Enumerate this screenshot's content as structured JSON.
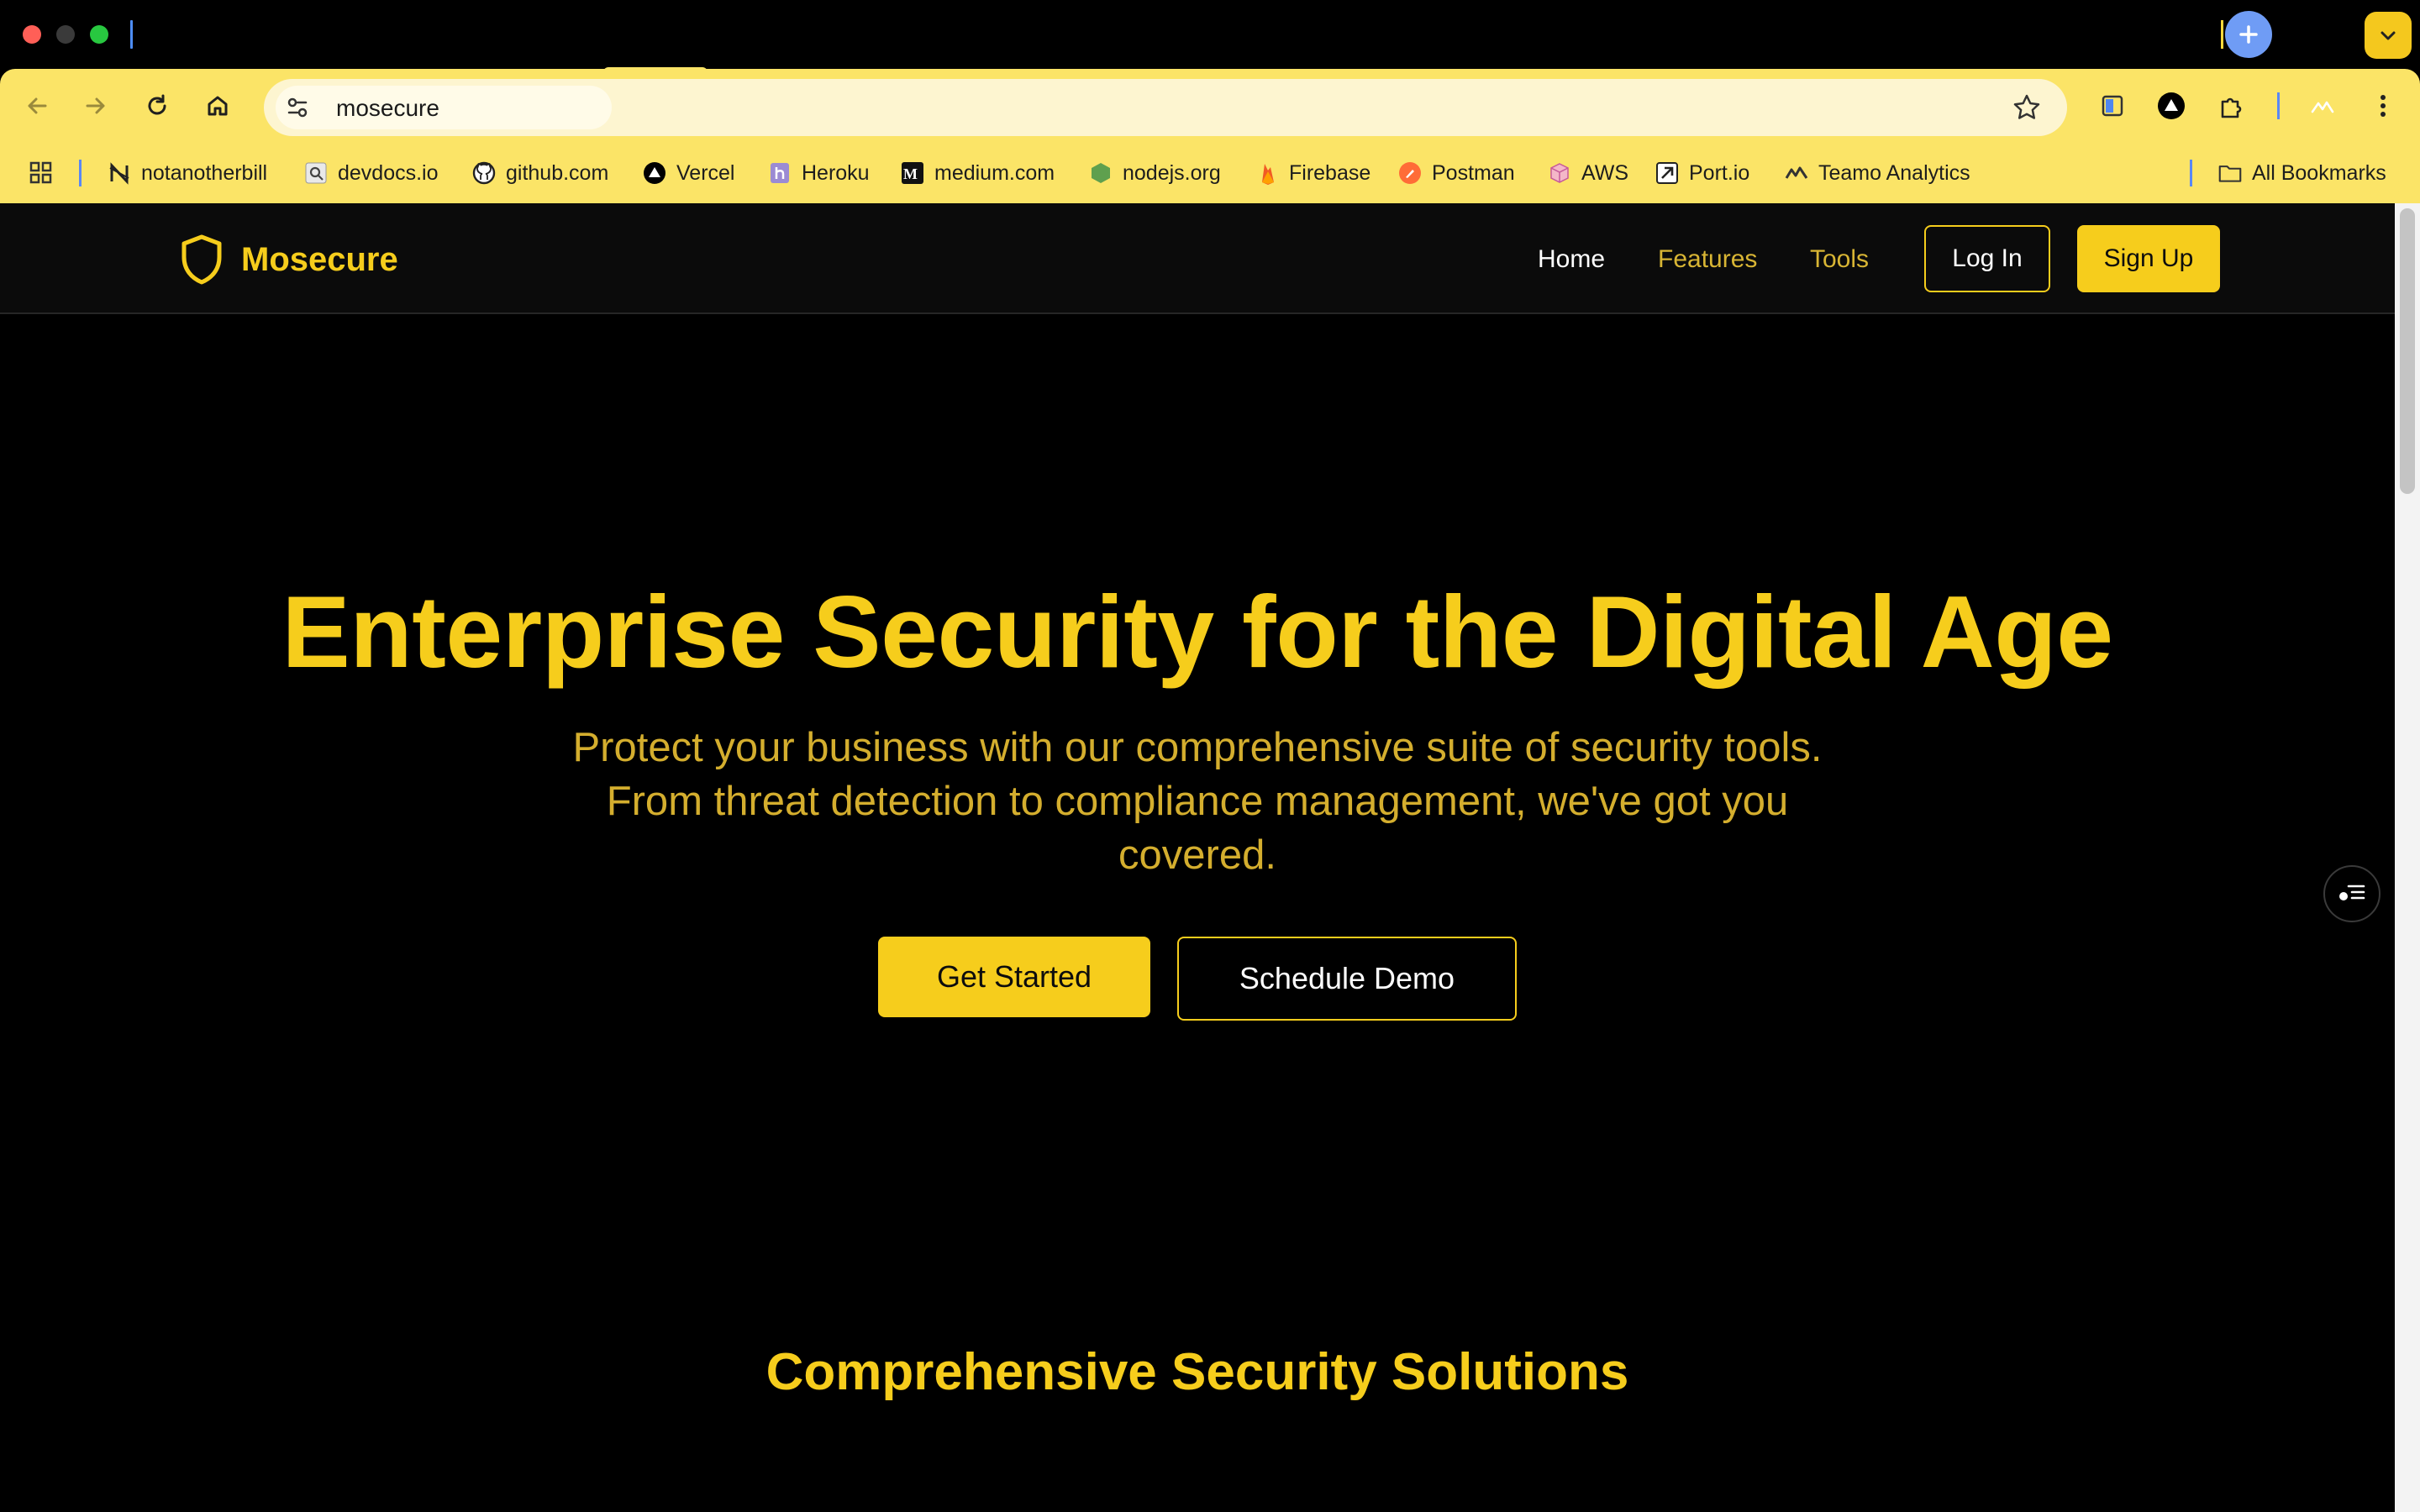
{
  "browser": {
    "address": "mosecure",
    "bookmarks": [
      {
        "label": "notanotherbill",
        "icon": "notanotherbill-icon"
      },
      {
        "label": "devdocs.io",
        "icon": "devdocs-icon"
      },
      {
        "label": "github.com",
        "icon": "github-icon"
      },
      {
        "label": "Vercel",
        "icon": "vercel-icon"
      },
      {
        "label": "Heroku",
        "icon": "heroku-icon"
      },
      {
        "label": "medium.com",
        "icon": "medium-icon"
      },
      {
        "label": "nodejs.org",
        "icon": "nodejs-icon"
      },
      {
        "label": "Firebase",
        "icon": "firebase-icon"
      },
      {
        "label": "Postman",
        "icon": "postman-icon"
      },
      {
        "label": "AWS",
        "icon": "aws-icon"
      },
      {
        "label": "Port.io",
        "icon": "port-icon"
      },
      {
        "label": "Teamo Analytics",
        "icon": "teamo-icon"
      }
    ],
    "all_bookmarks": "All Bookmarks"
  },
  "site": {
    "brand": "Mosecure",
    "nav": {
      "home": "Home",
      "features": "Features",
      "tools": "Tools",
      "login": "Log In",
      "signup": "Sign Up"
    },
    "hero": {
      "title": "Enterprise Security for the Digital Age",
      "subtitle": "Protect your business with our comprehensive suite of security tools. From threat detection to compliance management, we've got you covered.",
      "primary_cta": "Get Started",
      "secondary_cta": "Schedule Demo"
    },
    "section_title": "Comprehensive Security Solutions"
  },
  "colors": {
    "accent": "#f6cd1c",
    "toolbar": "#fbe467",
    "background": "#000000"
  }
}
